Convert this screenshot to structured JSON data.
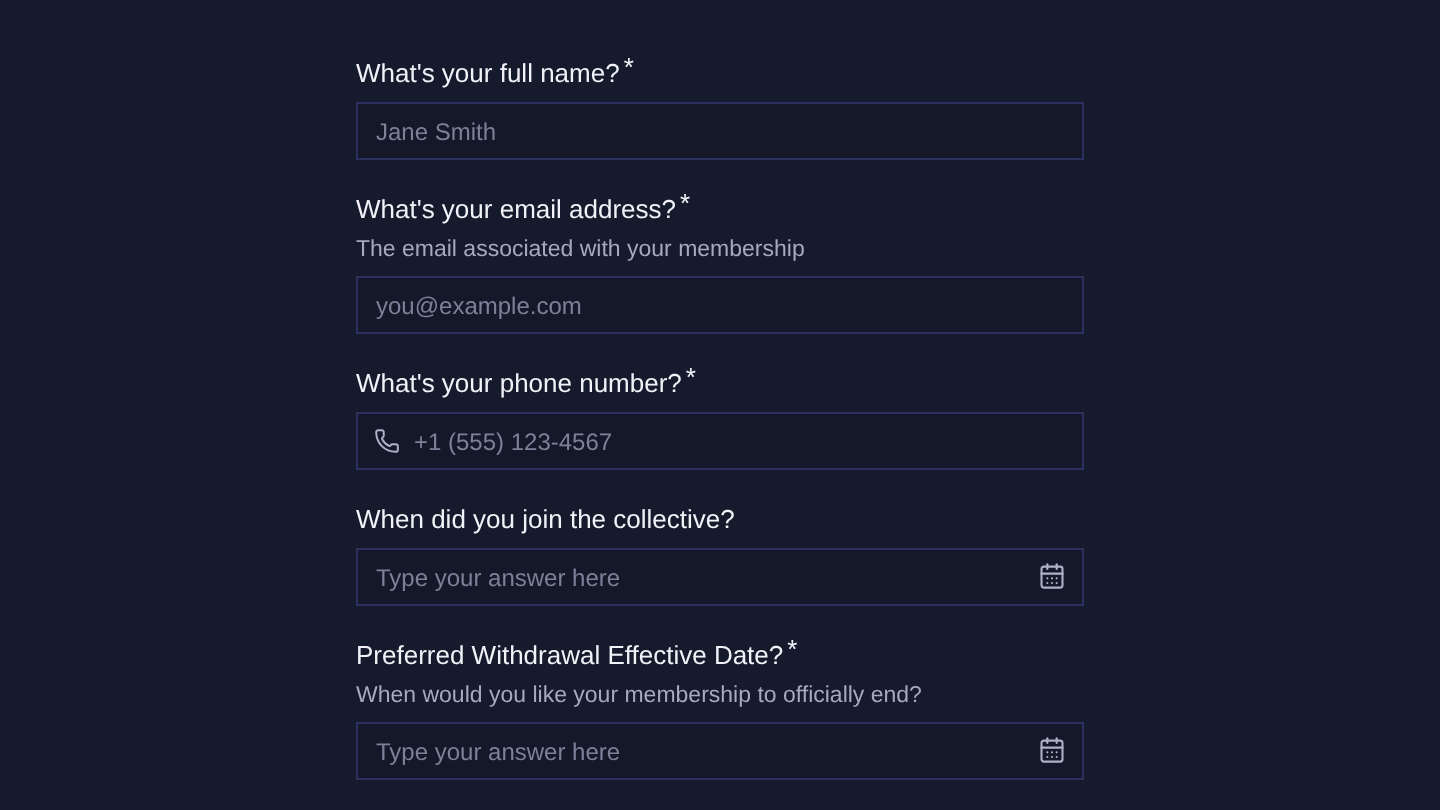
{
  "fields": [
    {
      "kind": "text",
      "label": "What's your full name?",
      "required_mark": "*",
      "placeholder": "Jane Smith"
    },
    {
      "kind": "text",
      "label": "What's your email address?",
      "required_mark": "*",
      "description": "The email associated with your membership",
      "placeholder": "you@example.com"
    },
    {
      "kind": "phone",
      "label": "What's your phone number?",
      "required_mark": "*",
      "placeholder": "+1 (555) 123-4567"
    },
    {
      "kind": "date",
      "label": "When did you join the collective?",
      "placeholder": "Type your answer here"
    },
    {
      "kind": "date",
      "label": "Preferred Withdrawal Effective Date?",
      "required_mark": "*",
      "description": "When would you like your membership to officially end?",
      "placeholder": "Type your answer here"
    }
  ]
}
